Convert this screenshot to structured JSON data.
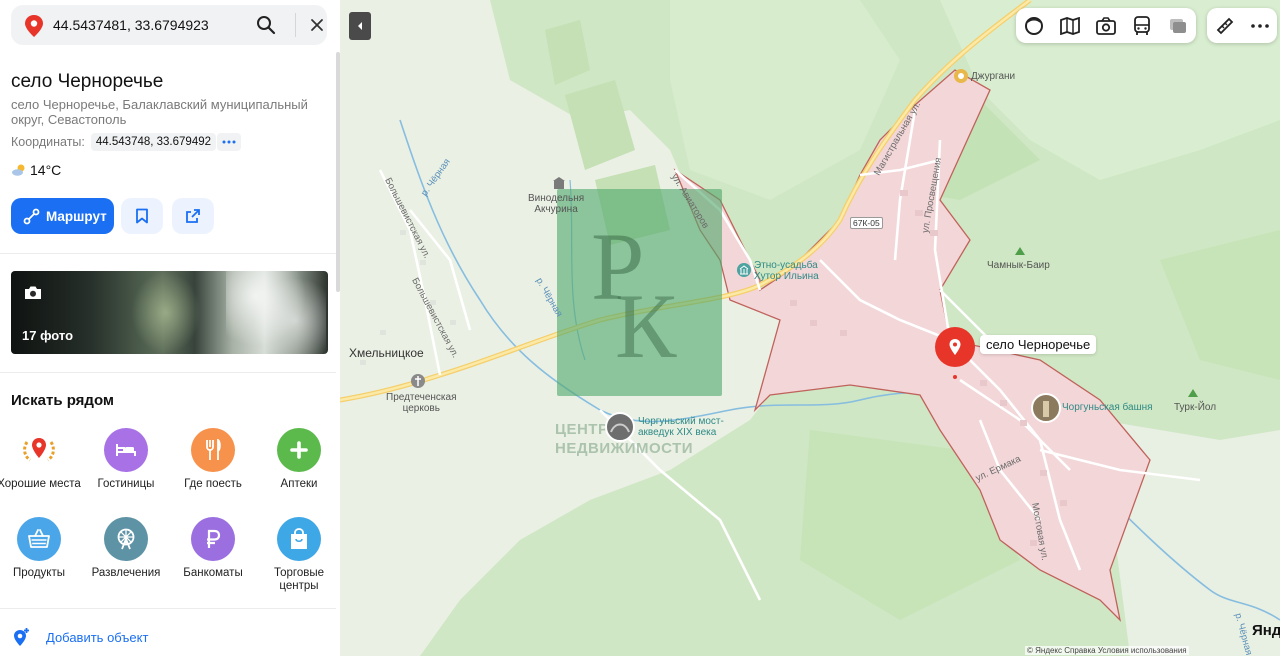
{
  "search": {
    "value": "44.5437481, 33.6794923"
  },
  "place": {
    "title": "село Черноречье",
    "address": "село Черноречье, Балаклавский муниципальный округ, Севастополь",
    "coords_label": "Координаты:",
    "coords_value": "44.543748, 33.679492",
    "weather": "14°C"
  },
  "actions": {
    "route_label": "Маршрут"
  },
  "photos": {
    "count_label": "17 фото"
  },
  "nearby": {
    "title": "Искать рядом",
    "categories": [
      {
        "label": "Хорошие места",
        "icon": "laurel-pin-icon",
        "color": "#ffffff"
      },
      {
        "label": "Гостиницы",
        "icon": "bed-icon",
        "color": "#a872e6"
      },
      {
        "label": "Где поесть",
        "icon": "fork-knife-icon",
        "color": "#f6924b"
      },
      {
        "label": "Аптеки",
        "icon": "plus-icon",
        "color": "#5cba4d"
      },
      {
        "label": "Продукты",
        "icon": "basket-icon",
        "color": "#4aa6e8"
      },
      {
        "label": "Развлечения",
        "icon": "ferris-wheel-icon",
        "color": "#5e93a6"
      },
      {
        "label": "Банкоматы",
        "icon": "ruble-icon",
        "color": "#9b6fe0"
      },
      {
        "label": "Торговые центры",
        "icon": "shopping-bag-icon",
        "color": "#3ea7e6"
      }
    ]
  },
  "add_object": {
    "label": "Добавить объект"
  },
  "map": {
    "selected_label": "село Черноречье",
    "road_badge": "67К-05",
    "watermark": {
      "line1": "ЦЕНТР",
      "line2": "НЕДВИЖИМОСТИ"
    },
    "labels": {
      "winery": "Винодельня\nАкчурина",
      "ethno": "Этно-усадьба\nХутор Ильина",
      "dzhurgani": "Джургани",
      "chamnyk": "Чамнык-Баир",
      "turk": "Турк-Йол",
      "khmelnitskoe": "Хмельницкое",
      "church": "Предтеченская\nцерковь",
      "bridge": "Чоргуньский мост-\nакведук XIX века",
      "tower": "Чоргуньская башня"
    },
    "streets": {
      "aviatorov": "ул. Авиаторов",
      "magistralnaya": "Магистральная ул.",
      "prosvescheniya": "ул. Просвещения",
      "bolsh1": "Большевистская ул.",
      "bolsh2": "Большевистская ул.",
      "ermaka": "ул. Ермака",
      "mostovaya": "Мостовая ул.",
      "river1": "р. Чёрная",
      "river2": "р. Чёрная",
      "river3": "р. Чёрная"
    },
    "copyright": "© Яндекс   Справка   Условия использования",
    "brand": "Янд"
  },
  "colors": {
    "accent": "#1a6ff2",
    "pin": "#e8352a",
    "village_fill": "#f3d6d8",
    "village_border": "#c0625c"
  }
}
